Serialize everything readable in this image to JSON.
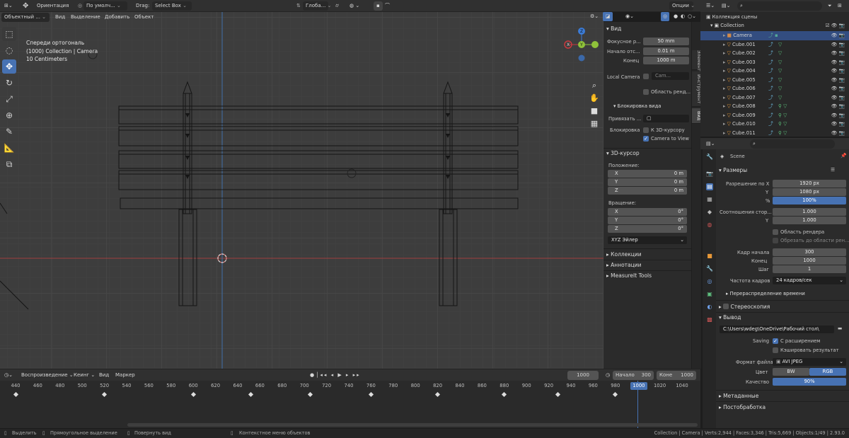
{
  "header": {
    "orientation": "Ориентация",
    "pivot": "По умолч...",
    "drag": "Drag:",
    "select_box": "Select Box",
    "view_transform": "Глоба...",
    "options": "Опции"
  },
  "viewport_header": {
    "mode": "Объектный ...",
    "view": "Вид",
    "select": "Выделение",
    "add": "Добавить",
    "object": "Объект"
  },
  "viewport_info": {
    "line1": "Спереди ортогональ",
    "line2": "(1000) Collection | Camera",
    "line3": "10 Centimeters"
  },
  "gizmo": {
    "x": "X",
    "y": "Y",
    "z": "Z"
  },
  "n_tabs": [
    "Элемент",
    "Инструмент",
    "Вид"
  ],
  "view_panel": {
    "title": "Вид",
    "focal_label": "Фокусное р...",
    "focal_value": "50 mm",
    "clip_start_label": "Начало отс...",
    "clip_start_value": "0.01 m",
    "clip_end_label": "Конец",
    "clip_end_value": "1000 m",
    "local_camera_label": "Local Camera",
    "local_camera_value": "Cam...",
    "render_region_label": "Область ренд...",
    "lock_title": "Блокировка вида",
    "lock_to_label": "Привязать ...",
    "lock_label": "Блокировка",
    "lock_cursor_label": "К 3D-курсору",
    "camera_to_view_label": "Camera to View"
  },
  "cursor_panel": {
    "title": "3D-курсор",
    "location_label": "Положение:",
    "loc": [
      {
        "axis": "X",
        "value": "0 m"
      },
      {
        "axis": "Y",
        "value": "0 m"
      },
      {
        "axis": "Z",
        "value": "0 m"
      }
    ],
    "rotation_label": "Вращение:",
    "rot": [
      {
        "axis": "X",
        "value": "0°"
      },
      {
        "axis": "Y",
        "value": "0°"
      },
      {
        "axis": "Z",
        "value": "0°"
      }
    ],
    "rotation_mode": "XYZ Эйлер"
  },
  "collapsed_panels": [
    "Коллекции",
    "Аннотации",
    "MeasureIt Tools"
  ],
  "outliner": {
    "scene_collection": "Коллекция сцены",
    "collection": "Collection",
    "items": [
      "Camera",
      "Cube.001",
      "Cube.002",
      "Cube.003",
      "Cube.004",
      "Cube.005",
      "Cube.006",
      "Cube.007",
      "Cube.008",
      "Cube.009",
      "Cube.010",
      "Cube.011"
    ]
  },
  "properties": {
    "scene": "Scene",
    "dimensions_title": "Размеры",
    "res_x_label": "Разрешение по X",
    "res_x": "1920 px",
    "res_y_label": "Y",
    "res_y": "1080 px",
    "pct_label": "%",
    "pct": "100%",
    "aspect_label": "Соотношения стор...",
    "aspect_x": "1.000",
    "aspect_y_label": "Y",
    "aspect_y": "1.000",
    "render_region": "Область рендера",
    "crop_region": "Обрезать до области рен...",
    "frame_start_label": "Кадр начала",
    "frame_start": "300",
    "frame_end_label": "Конец",
    "frame_end": "1000",
    "frame_step_label": "Шаг",
    "frame_step": "1",
    "fps_label": "Частота кадров",
    "fps": "24 кадров/сек",
    "time_remap": "Перераспределение времени",
    "stereo": "Стереоскопия",
    "output_title": "Вывод",
    "output_path": "C:\\Users\\wdeg\\OneDrive\\Рабочий стол\\",
    "saving_label": "Saving",
    "file_ext": "С расширением",
    "cache_result": "Кэшировать результат",
    "file_format_label": "Формат файла",
    "file_format": "AVI JPEG",
    "color_label": "Цвет",
    "bw": "BW",
    "rgb": "RGB",
    "quality_label": "Качество",
    "quality": "90%",
    "metadata": "Метаданные",
    "postprocessing": "Постобработка"
  },
  "timeline_header": {
    "playback": "Воспроизведение",
    "keying": "Кеинг",
    "view": "Вид",
    "marker": "Маркер",
    "current": "1000",
    "start_label": "Начало",
    "start": "300",
    "end_label": "Коне",
    "end": "1000"
  },
  "timeline": {
    "ticks": [
      "440",
      "460",
      "480",
      "500",
      "520",
      "540",
      "560",
      "580",
      "600",
      "620",
      "640",
      "660",
      "680",
      "700",
      "720",
      "740",
      "760",
      "780",
      "800",
      "820",
      "840",
      "860",
      "880",
      "900",
      "920",
      "940",
      "960",
      "980",
      "1000",
      "1020",
      "1040"
    ],
    "current_frame": "1000",
    "current_value": 1000,
    "keyframes": [
      440,
      520,
      600,
      652,
      705,
      760,
      820,
      880,
      928,
      980
    ]
  },
  "status": {
    "select": "Выделить",
    "box_select": "Прямоугольное выделение",
    "rotate_view": "Повернуть вид",
    "context_menu": "Контекстное меню объектов",
    "stats": "Collection | Camera | Verts:2,944 | Faces:3,346 | Tris:5,669 | Objects:1/49 | 2.93.0"
  }
}
